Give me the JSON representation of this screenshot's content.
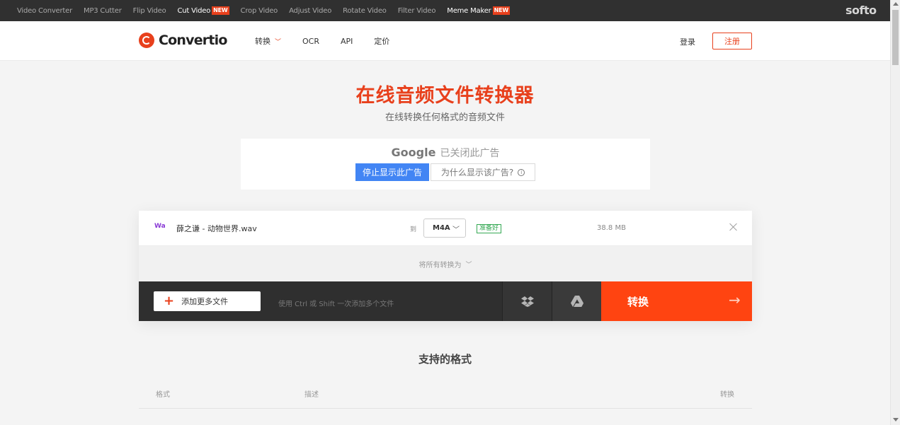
{
  "softo_bar": {
    "links": [
      {
        "label": "Video Converter",
        "badge": "",
        "highlight": false
      },
      {
        "label": "MP3 Cutter",
        "badge": "",
        "highlight": false
      },
      {
        "label": "Flip Video",
        "badge": "",
        "highlight": false
      },
      {
        "label": "Cut Video",
        "badge": "NEW",
        "highlight": true
      },
      {
        "label": "Crop Video",
        "badge": "",
        "highlight": false
      },
      {
        "label": "Adjust Video",
        "badge": "",
        "highlight": false
      },
      {
        "label": "Rotate Video",
        "badge": "",
        "highlight": false
      },
      {
        "label": "Filter Video",
        "badge": "",
        "highlight": false
      },
      {
        "label": "Meme Maker",
        "badge": "NEW",
        "highlight": true
      }
    ],
    "brand": "softo"
  },
  "header": {
    "logo_text": "Convertio",
    "nav": [
      {
        "label": "转换",
        "has_dropdown": true
      },
      {
        "label": "OCR",
        "has_dropdown": false
      },
      {
        "label": "API",
        "has_dropdown": false
      },
      {
        "label": "定价",
        "has_dropdown": false
      }
    ],
    "login": "登录",
    "signup": "注册"
  },
  "hero": {
    "title": "在线音频文件转换器",
    "subtitle": "在线转换任何格式的音频文件"
  },
  "ad": {
    "google": "Google",
    "closed_text": "已关闭此广告",
    "stop_button": "停止显示此广告",
    "why_button": "为什么显示该广告?",
    "info_glyph": "i"
  },
  "file": {
    "type_icon": "Wa",
    "name": "薛之谦 - 动物世界.wav",
    "to_label": "到",
    "target_format": "M4A",
    "status": "准备好",
    "size": "38.8 MB"
  },
  "convert_all": {
    "label": "将所有转换为"
  },
  "actions": {
    "add_more": "添加更多文件",
    "hint": "使用 Ctrl 或 Shift 一次添加多个文件",
    "convert": "转换"
  },
  "formats": {
    "title": "支持的格式",
    "columns": [
      "格式",
      "描述",
      "转换"
    ]
  },
  "colors": {
    "accent": "#e8401c",
    "convert_button": "#ff4411",
    "google_blue": "#4285f4",
    "ready_green": "#34a853"
  }
}
